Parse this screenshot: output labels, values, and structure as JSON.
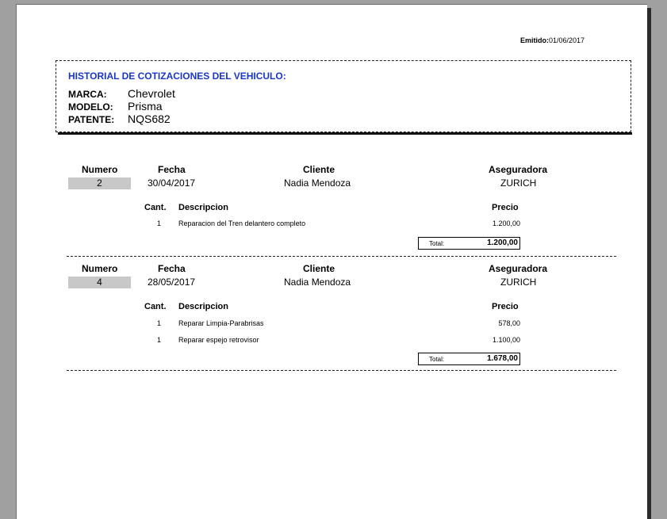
{
  "emitted": {
    "label": "Emitido:",
    "date": "01/06/2017"
  },
  "header": {
    "title": "HISTORIAL DE COTIZACIONES DEL VEHICULO:",
    "marca_label": "MARCA:",
    "marca": "Chevrolet",
    "modelo_label": "MODELO:",
    "modelo": "Prisma",
    "patente_label": "PATENTE:",
    "patente": "NQS682"
  },
  "columns": {
    "numero": "Numero",
    "fecha": "Fecha",
    "cliente": "Cliente",
    "aseguradora": "Aseguradora",
    "cant": "Cant.",
    "descripcion": "Descripcion",
    "precio": "Precio",
    "total": "Total:"
  },
  "quotes": [
    {
      "numero": "2",
      "fecha": "30/04/2017",
      "cliente": "Nadia Mendoza",
      "aseguradora": "ZURICH",
      "items": [
        {
          "cant": "1",
          "descripcion": "Reparacion del Tren delantero completo",
          "precio": "1.200,00"
        }
      ],
      "total": "1.200,00"
    },
    {
      "numero": "4",
      "fecha": "28/05/2017",
      "cliente": "Nadia Mendoza",
      "aseguradora": "ZURICH",
      "items": [
        {
          "cant": "1",
          "descripcion": "Reparar Limpia-Parabrisas",
          "precio": "578,00"
        },
        {
          "cant": "1",
          "descripcion": "Reparar espejo retrovisor",
          "precio": "1.100,00"
        }
      ],
      "total": "1.678,00"
    }
  ]
}
